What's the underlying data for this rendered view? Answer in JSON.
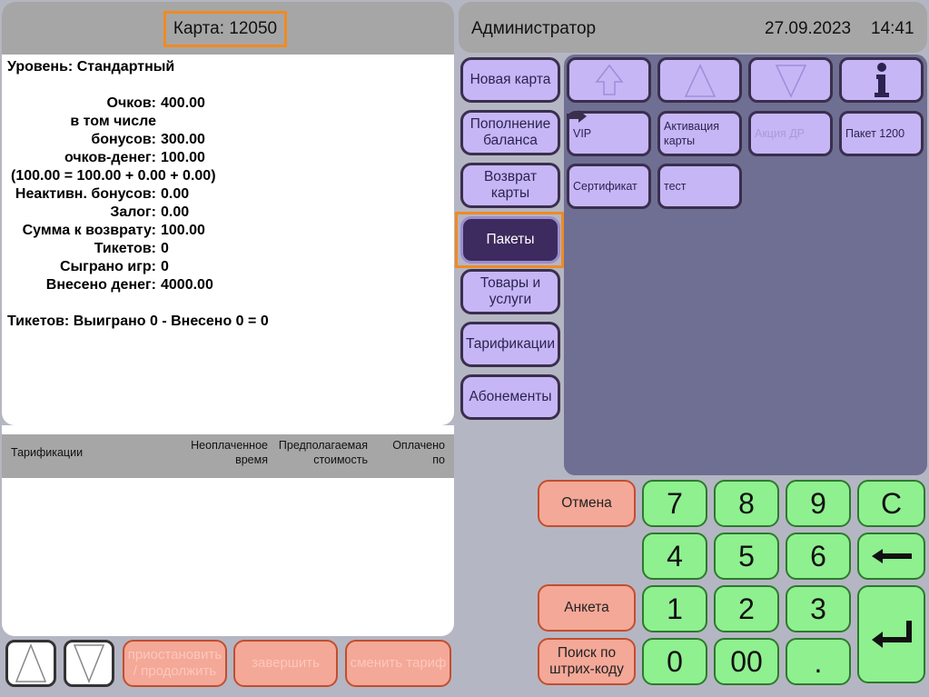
{
  "card": {
    "label": "Карта: 12050"
  },
  "info": {
    "level": "Уровень: Стандартный",
    "rows": [
      {
        "label": "Очков:",
        "value": "400.00"
      },
      {
        "label": "в том числе",
        "value": ""
      },
      {
        "label": "бонусов:",
        "value": "300.00"
      },
      {
        "label": "очков-денег:",
        "value": "100.00"
      },
      {
        "label": "",
        "value": ""
      },
      {
        "label": "Неактивн. бонусов:",
        "value": "0.00"
      },
      {
        "label": "Залог:",
        "value": "0.00"
      },
      {
        "label": "Сумма к возврату:",
        "value": "100.00"
      },
      {
        "label": "Тикетов:",
        "value": "0"
      },
      {
        "label": "Сыграно игр:",
        "value": "0"
      },
      {
        "label": "Внесено денег:",
        "value": "4000.00"
      }
    ],
    "formula": "(100.00 = 100.00 + 0.00 + 0.00)",
    "tickets_summary": "Тикетов: Выиграно 0 - Внесено 0 = 0"
  },
  "tariffs": {
    "col1": "Тарификации",
    "col2": "Неоплаченное время",
    "col3": "Предполагаемая стоимость",
    "col4": "Оплачено по"
  },
  "toolbar": {
    "pause_resume": "приостановить / продолжить",
    "finish": "завершить",
    "change_tariff": "сменить тариф"
  },
  "header": {
    "user": "Администратор",
    "date": "27.09.2023",
    "time": "14:41"
  },
  "categories": [
    {
      "label": "Новая карта"
    },
    {
      "label": "Пополнение баланса"
    },
    {
      "label": "Возврат карты"
    },
    {
      "label": "Пакеты"
    },
    {
      "label": "Товары и услуги"
    },
    {
      "label": "Тарификации"
    },
    {
      "label": "Абонементы"
    }
  ],
  "grid": {
    "row2": [
      "VIP",
      "Активация карты",
      "Акция ДР",
      "Пакет 1200"
    ],
    "row3": [
      "Сертификат",
      "тест"
    ]
  },
  "keypad": {
    "cancel": "Отмена",
    "survey": "Анкета",
    "barcode": "Поиск по штрих-коду",
    "keys": [
      "7",
      "8",
      "9",
      "C",
      "4",
      "5",
      "6",
      "1",
      "2",
      "3",
      "0",
      "00",
      "."
    ]
  },
  "colors": {
    "accent": "#f08a24",
    "selected_category": "#3d2a5e",
    "category": "#c6b6f6",
    "keypad": "#8ff08f",
    "action": "#f4a898"
  }
}
